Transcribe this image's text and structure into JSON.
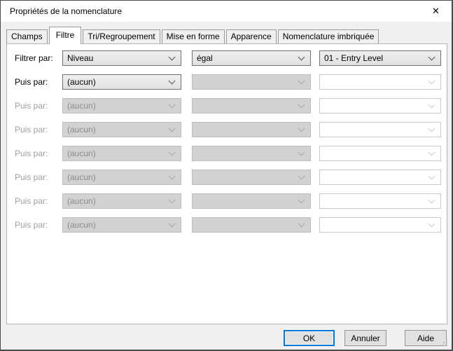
{
  "window": {
    "title": "Propriétés de la nomenclature",
    "close_glyph": "✕"
  },
  "tabs": [
    {
      "label": "Champs",
      "active": false
    },
    {
      "label": "Filtre",
      "active": true
    },
    {
      "label": "Tri/Regroupement",
      "active": false
    },
    {
      "label": "Mise en forme",
      "active": false
    },
    {
      "label": "Apparence",
      "active": false
    },
    {
      "label": "Nomenclature imbriquée",
      "active": false
    }
  ],
  "filter": {
    "rows": [
      {
        "label": "Filtrer par:",
        "field": "Niveau",
        "operator": "égal",
        "value": "01 - Entry Level"
      },
      {
        "label": "Puis par:",
        "field": "(aucun)",
        "operator": "",
        "value": ""
      },
      {
        "label": "Puis par:",
        "field": "(aucun)",
        "operator": "",
        "value": ""
      },
      {
        "label": "Puis par:",
        "field": "(aucun)",
        "operator": "",
        "value": ""
      },
      {
        "label": "Puis par:",
        "field": "(aucun)",
        "operator": "",
        "value": ""
      },
      {
        "label": "Puis par:",
        "field": "(aucun)",
        "operator": "",
        "value": ""
      },
      {
        "label": "Puis par:",
        "field": "(aucun)",
        "operator": "",
        "value": ""
      },
      {
        "label": "Puis par:",
        "field": "(aucun)",
        "operator": "",
        "value": ""
      }
    ]
  },
  "footer": {
    "ok_label": "OK",
    "cancel_label": "Annuler",
    "help_label": "Aide"
  },
  "colors": {
    "accent_blue": "#0078d7",
    "dialog_bg": "#f0f0f0",
    "disabled_text": "#8b8b8b",
    "combo_border_enabled": "#707070"
  }
}
